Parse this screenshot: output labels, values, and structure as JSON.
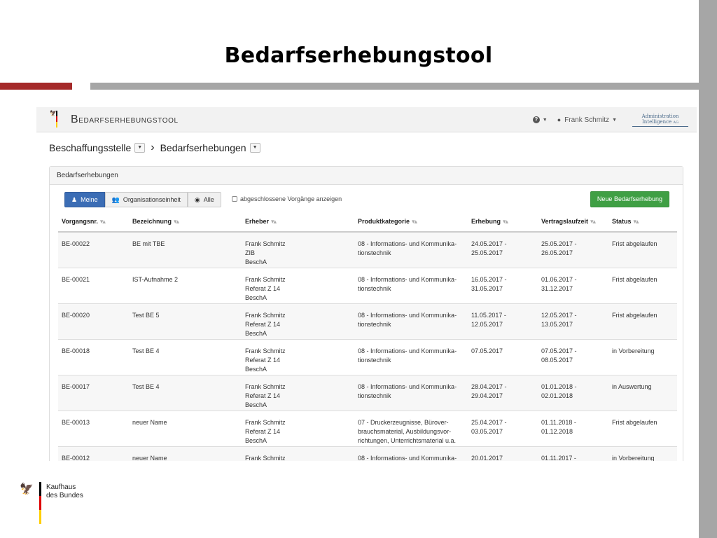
{
  "slide": {
    "title": "Bedarfserhebungstool"
  },
  "app": {
    "name": "Bedarfserhebungstool",
    "user": "Frank Schmitz",
    "help_icon": "question-circle-icon",
    "logo_text_1": "Administration",
    "logo_text_2": "Intelligence",
    "logo_text_3": "AG"
  },
  "breadcrumb": {
    "item1": "Beschaffungsstelle",
    "item2": "Bedarfserhebungen"
  },
  "panel": {
    "title": "Bedarfserhebungen",
    "filters": {
      "mine": "Meine",
      "org": "Organisationseinheit",
      "all": "Alle"
    },
    "show_closed": "abgeschlossene Vorgänge anzeigen",
    "new_button": "Neue Bedarfserhebung"
  },
  "table": {
    "headers": [
      "Vorgangsnr.",
      "Bezeichnung",
      "Erheber",
      "Produktkategorie",
      "Erhebung",
      "Vertragslaufzeit",
      "Status"
    ],
    "sort_glyph": "▾▴",
    "rows": [
      {
        "nr": "BE-00022",
        "bez": "BE mit TBE",
        "erh1": "Frank Schmitz",
        "erh2": "ZIB",
        "erh3": "BeschA",
        "kat1": "08 - Informations- und Kommunika-",
        "kat2": "tionstechnik",
        "kat3": "",
        "erhb1": "24.05.2017 -",
        "erhb2": "25.05.2017",
        "vl1": "25.05.2017 -",
        "vl2": "26.05.2017",
        "status": "Frist abgelaufen"
      },
      {
        "nr": "BE-00021",
        "bez": "IST-Aufnahme 2",
        "erh1": "Frank Schmitz",
        "erh2": "Referat Z 14",
        "erh3": "BeschA",
        "kat1": "08 - Informations- und Kommunika-",
        "kat2": "tionstechnik",
        "kat3": "",
        "erhb1": "16.05.2017 -",
        "erhb2": "31.05.2017",
        "vl1": "01.06.2017 -",
        "vl2": "31.12.2017",
        "status": "Frist abgelaufen"
      },
      {
        "nr": "BE-00020",
        "bez": "Test BE 5",
        "erh1": "Frank Schmitz",
        "erh2": "Referat Z 14",
        "erh3": "BeschA",
        "kat1": "08 - Informations- und Kommunika-",
        "kat2": "tionstechnik",
        "kat3": "",
        "erhb1": "11.05.2017 -",
        "erhb2": "12.05.2017",
        "vl1": "12.05.2017 -",
        "vl2": "13.05.2017",
        "status": "Frist abgelaufen"
      },
      {
        "nr": "BE-00018",
        "bez": "Test BE 4",
        "erh1": "Frank Schmitz",
        "erh2": "Referat Z 14",
        "erh3": "BeschA",
        "kat1": "08 - Informations- und Kommunika-",
        "kat2": "tionstechnik",
        "kat3": "",
        "erhb1": "07.05.2017",
        "erhb2": "",
        "vl1": "07.05.2017 -",
        "vl2": "08.05.2017",
        "status": "in Vorbereitung"
      },
      {
        "nr": "BE-00017",
        "bez": "Test BE 4",
        "erh1": "Frank Schmitz",
        "erh2": "Referat Z 14",
        "erh3": "BeschA",
        "kat1": "08 - Informations- und Kommunika-",
        "kat2": "tionstechnik",
        "kat3": "",
        "erhb1": "28.04.2017 -",
        "erhb2": "29.04.2017",
        "vl1": "01.01.2018 -",
        "vl2": "02.01.2018",
        "status": "in Auswertung"
      },
      {
        "nr": "BE-00013",
        "bez": "neuer Name",
        "erh1": "Frank Schmitz",
        "erh2": "Referat Z 14",
        "erh3": "BeschA",
        "kat1": "07 - Druckerzeugnisse, Bürover-",
        "kat2": "brauchsmaterial, Ausbildungsvor-",
        "kat3": "richtungen, Unterrichtsmaterial u.a.",
        "erhb1": "25.04.2017 -",
        "erhb2": "03.05.2017",
        "vl1": "01.11.2018 -",
        "vl2": "01.12.2018",
        "status": "Frist abgelaufen"
      },
      {
        "nr": "BE-00012",
        "bez": "neuer Name",
        "erh1": "Frank Schmitz",
        "erh2": "",
        "erh3": "",
        "kat1": "08 - Informations- und Kommunika-",
        "kat2": "",
        "kat3": "",
        "erhb1": "20.01.2017",
        "erhb2": "",
        "vl1": "01.11.2017 -",
        "vl2": "",
        "status": "in Vorbereitung"
      }
    ]
  },
  "footer": {
    "org_line1": "Kaufhaus",
    "org_line2": "des Bundes"
  },
  "colors": {
    "primary": "#3b6db5",
    "success": "#3f9f44",
    "accent_red": "#a52a2a",
    "bar_grey": "#a6a6a6",
    "flag_black": "#000000",
    "flag_red": "#dd0000",
    "flag_gold": "#ffce00"
  }
}
